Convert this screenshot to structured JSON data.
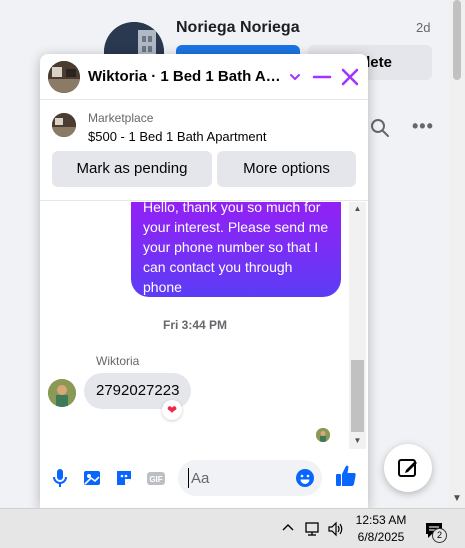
{
  "background": {
    "contact_name": "Noriega Noriega",
    "contact_time": "2d",
    "delete_label": "lete"
  },
  "chat": {
    "title": "Wiktoria · 1 Bed 1 Bath Ap...",
    "listing": {
      "source": "Marketplace",
      "title": "$500 - 1 Bed 1 Bath Apartment",
      "mark_pending_label": "Mark as pending",
      "more_options_label": "More options"
    },
    "messages": {
      "outgoing_text": "Hello, thank you so much for your interest. Please send me your phone number so that I can contact you through phone",
      "timestamp": "Fri 3:44 PM",
      "sender": "Wiktoria",
      "incoming_text": "2792027223",
      "reaction": "❤"
    },
    "composer": {
      "placeholder": "Aa"
    }
  },
  "taskbar": {
    "time": "12:53 AM",
    "date": "6/8/2025",
    "notification_count": "2"
  },
  "colors": {
    "accent": "#1b74e4",
    "messenger_purple": "#a033ff",
    "outgoing_gradient_top": "#9b1bf5",
    "outgoing_gradient_bottom": "#5c3cf6"
  },
  "icons": [
    "mic-icon",
    "photo-icon",
    "sticker-icon",
    "gif-icon",
    "emoji-icon",
    "like-icon",
    "chevron-down-icon",
    "minimize-icon",
    "close-icon",
    "new-message-icon",
    "search-icon",
    "more-icon"
  ]
}
